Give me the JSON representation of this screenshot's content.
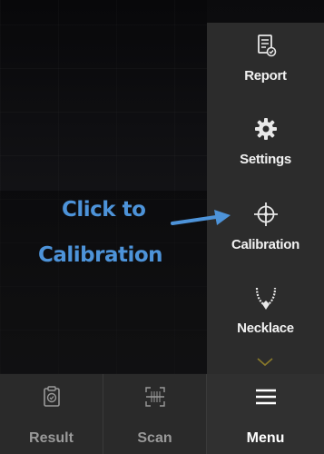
{
  "sidebar": {
    "items": [
      {
        "label": "Report",
        "icon": "report-icon"
      },
      {
        "label": "Settings",
        "icon": "gear-icon"
      },
      {
        "label": "Calibration",
        "icon": "crosshair-icon"
      },
      {
        "label": "Necklace",
        "icon": "necklace-icon"
      }
    ],
    "more_icon": "chevron-down-icon"
  },
  "annotation": {
    "line1": "Click to",
    "line2": "Calibration",
    "color": "#4d93d9"
  },
  "bottom_bar": {
    "tabs": [
      {
        "label": "Result",
        "icon": "clipboard-icon"
      },
      {
        "label": "Scan",
        "icon": "scan-icon"
      },
      {
        "label": "Menu",
        "icon": "hamburger-icon"
      }
    ]
  },
  "colors": {
    "menu_bg": "#2c2c2c",
    "accent_chevron": "#8a7a2a",
    "text_light": "#f1f1f1",
    "text_dim": "#9a9a9a"
  }
}
